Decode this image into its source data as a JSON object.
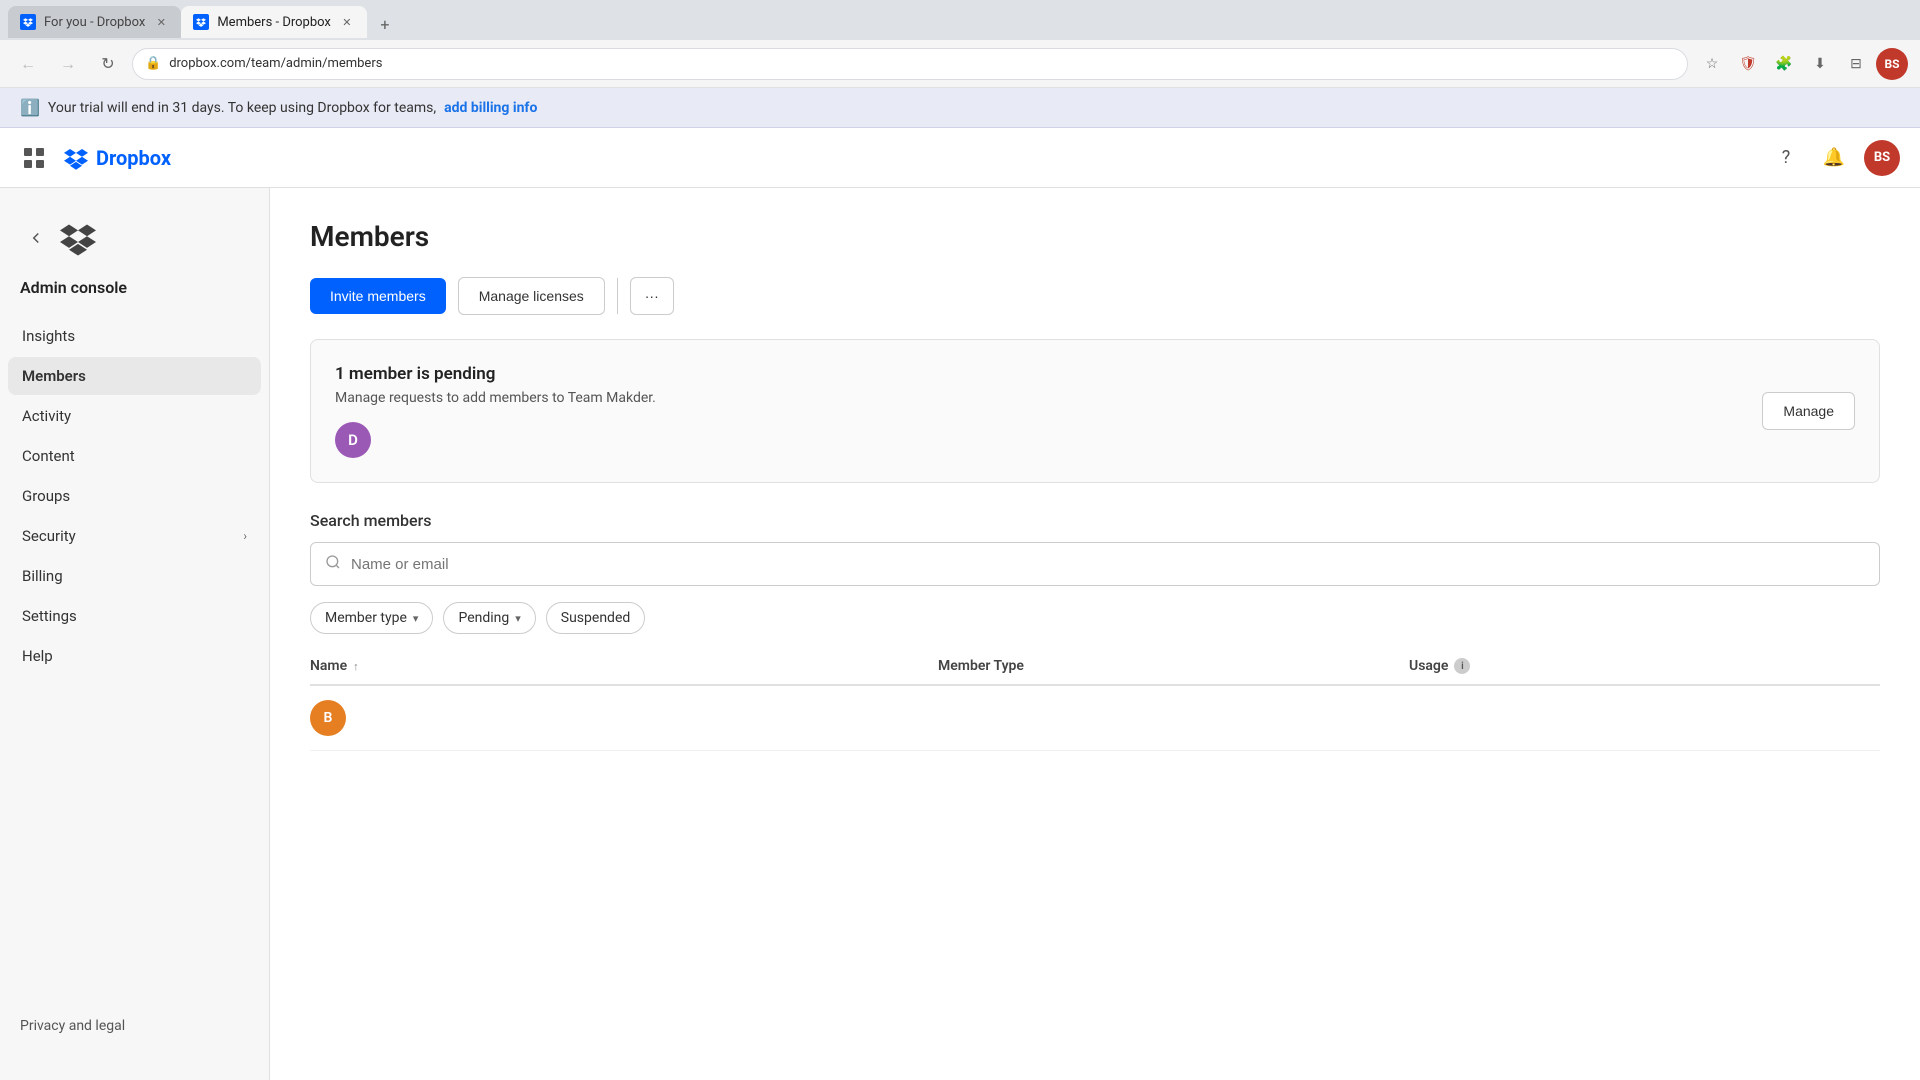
{
  "browser": {
    "tabs": [
      {
        "id": "tab1",
        "label": "For you - Dropbox",
        "favicon": "dropbox",
        "active": false
      },
      {
        "id": "tab2",
        "label": "Members - Dropbox",
        "favicon": "dropbox",
        "active": true
      }
    ],
    "address": "dropbox.com/team/admin/members",
    "new_tab_label": "+"
  },
  "trial_banner": {
    "text": "Your trial will end in 31 days. To keep using Dropbox for teams,",
    "link_text": "add billing info"
  },
  "topbar": {
    "logo_text": "Dropbox",
    "profile_initials": "BS"
  },
  "sidebar": {
    "admin_console_label": "Admin console",
    "nav_items": [
      {
        "id": "insights",
        "label": "Insights",
        "active": false
      },
      {
        "id": "members",
        "label": "Members",
        "active": true
      },
      {
        "id": "activity",
        "label": "Activity",
        "active": false
      },
      {
        "id": "content",
        "label": "Content",
        "active": false
      },
      {
        "id": "groups",
        "label": "Groups",
        "active": false
      },
      {
        "id": "security",
        "label": "Security",
        "active": false,
        "has_expand": true
      },
      {
        "id": "billing",
        "label": "Billing",
        "active": false
      },
      {
        "id": "settings",
        "label": "Settings",
        "active": false
      },
      {
        "id": "help",
        "label": "Help",
        "active": false
      }
    ],
    "bottom_link": "Privacy and legal"
  },
  "main": {
    "page_title": "Members",
    "buttons": {
      "invite": "Invite members",
      "manage_licenses": "Manage licenses",
      "more": "···"
    },
    "pending_banner": {
      "title": "1 member is pending",
      "subtitle": "Manage requests to add members to Team Makder.",
      "avatar_initial": "D",
      "manage_btn": "Manage"
    },
    "search": {
      "label": "Search members",
      "placeholder": "Name or email"
    },
    "filters": [
      {
        "id": "member_type",
        "label": "Member type",
        "has_chevron": true
      },
      {
        "id": "pending",
        "label": "Pending",
        "has_chevron": true
      },
      {
        "id": "suspended",
        "label": "Suspended",
        "has_chevron": false
      }
    ],
    "table": {
      "columns": [
        {
          "id": "name",
          "label": "Name",
          "has_sort": true
        },
        {
          "id": "member_type",
          "label": "Member Type",
          "has_sort": false
        },
        {
          "id": "usage",
          "label": "Usage",
          "has_info": true
        }
      ]
    },
    "table_row_preview": {
      "avatar_initial": "B",
      "avatar_color": "#e67e22"
    }
  }
}
